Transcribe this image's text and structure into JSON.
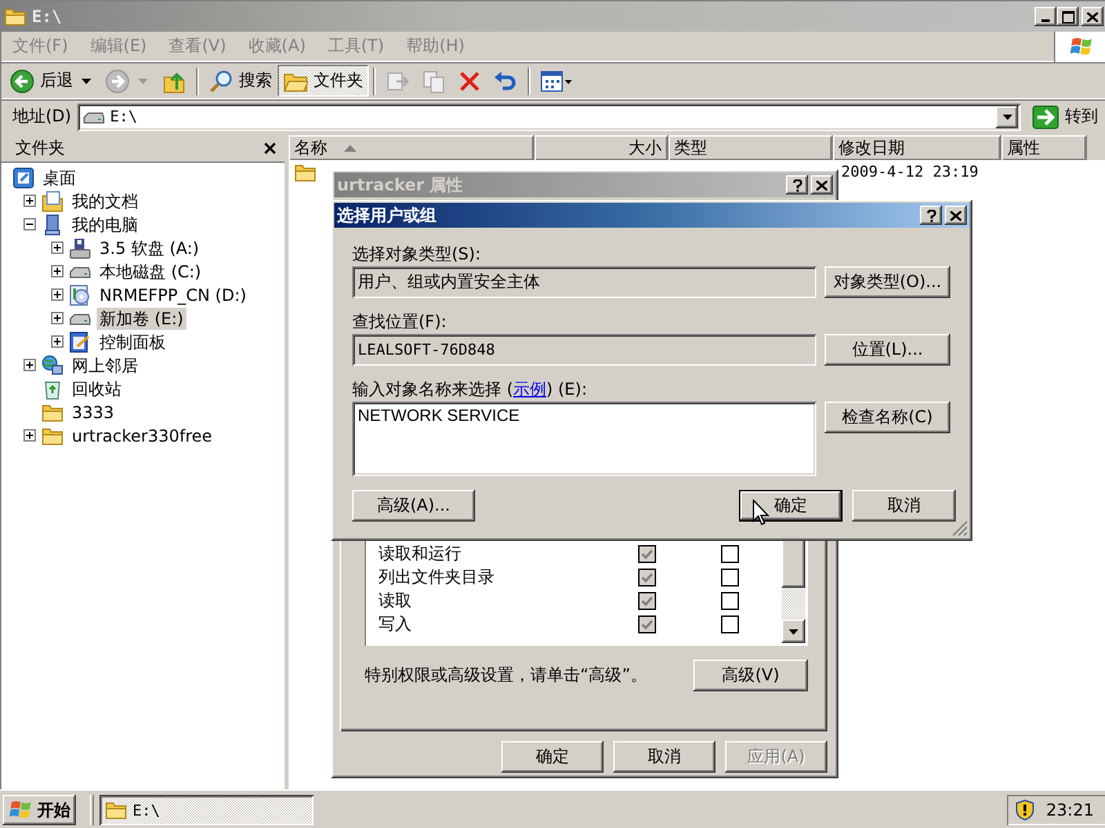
{
  "explorer": {
    "title": "E:\\",
    "menu": [
      "文件(F)",
      "编辑(E)",
      "查看(V)",
      "收藏(A)",
      "工具(T)",
      "帮助(H)"
    ],
    "toolbar": [
      {
        "kind": "back",
        "label": "后退"
      },
      {
        "kind": "forward"
      },
      {
        "kind": "up"
      },
      {
        "kind": "search",
        "label": "搜索",
        "pressed": false
      },
      {
        "kind": "folders",
        "label": "文件夹",
        "pressed": true
      },
      {
        "kind": "move"
      },
      {
        "kind": "copy"
      },
      {
        "kind": "delete"
      },
      {
        "kind": "undo"
      },
      {
        "kind": "views"
      }
    ],
    "address": {
      "label": "地址(D)",
      "value": "E:\\",
      "go": "转到"
    },
    "folders_pane": {
      "title": "文件夹",
      "tree": [
        {
          "label": "桌面",
          "kind": "desktop",
          "expandable": false,
          "selected": false,
          "children": [
            {
              "label": "我的文档",
              "kind": "documents",
              "expandable": true,
              "expanded": false,
              "selected": false
            },
            {
              "label": "我的电脑",
              "kind": "computer",
              "expandable": true,
              "expanded": true,
              "selected": false,
              "children": [
                {
                  "label": "3.5 软盘 (A:)",
                  "kind": "floppy",
                  "expandable": true,
                  "expanded": false,
                  "selected": false
                },
                {
                  "label": "本地磁盘 (C:)",
                  "kind": "drive",
                  "expandable": true,
                  "expanded": false,
                  "selected": false
                },
                {
                  "label": "NRMEFPP_CN (D:)",
                  "kind": "cd",
                  "expandable": true,
                  "expanded": false,
                  "selected": false
                },
                {
                  "label": "新加卷 (E:)",
                  "kind": "drive",
                  "expandable": true,
                  "expanded": false,
                  "selected": true
                },
                {
                  "label": "控制面板",
                  "kind": "control",
                  "expandable": true,
                  "expanded": false,
                  "selected": false
                }
              ]
            },
            {
              "label": "网上邻居",
              "kind": "network",
              "expandable": true,
              "expanded": false,
              "selected": false
            },
            {
              "label": "回收站",
              "kind": "recycle",
              "expandable": false,
              "selected": false
            },
            {
              "label": "3333",
              "kind": "folder",
              "expandable": false,
              "selected": false
            },
            {
              "label": "urtracker330free",
              "kind": "folder",
              "expandable": true,
              "expanded": false,
              "selected": false
            }
          ]
        }
      ]
    },
    "file_list": {
      "columns": [
        {
          "label": "名称",
          "sorted": true
        },
        {
          "label": "大小",
          "sorted": false
        },
        {
          "label": "类型",
          "sorted": false
        },
        {
          "label": "修改日期",
          "sorted": false
        },
        {
          "label": "属性",
          "sorted": false
        }
      ],
      "rows": [
        {
          "modified": "2009-4-12 23:19"
        }
      ]
    }
  },
  "properties_dialog": {
    "title": "urtracker 属性",
    "permissions": [
      {
        "name": "读取和运行",
        "allow": true,
        "allow_inherited": true,
        "deny": false
      },
      {
        "name": "列出文件夹目录",
        "allow": true,
        "allow_inherited": true,
        "deny": false
      },
      {
        "name": "读取",
        "allow": true,
        "allow_inherited": true,
        "deny": false
      },
      {
        "name": "写入",
        "allow": true,
        "allow_inherited": true,
        "deny": false
      }
    ],
    "advanced_hint": "特别权限或高级设置，请单击“高级”。",
    "advanced_button": "高级(V)",
    "buttons": [
      {
        "label": "确定",
        "disabled": false
      },
      {
        "label": "取消",
        "disabled": false
      },
      {
        "label": "应用(A)",
        "disabled": true
      }
    ]
  },
  "select_dialog": {
    "title": "选择用户或组",
    "object_type_label": "选择对象类型(S):",
    "object_type": "用户、组或内置安全主体",
    "object_type_button": "对象类型(O)...",
    "location_label": "查找位置(F):",
    "location": "LEALSOFT-76D848",
    "location_button": "位置(L)...",
    "names_label_before": "输入对象名称来选择 (",
    "example_link": "示例",
    "names_label_after": ") (E):",
    "names_value": "NETWORK SERVICE",
    "check_button": "检查名称(C)",
    "advanced_button": "高级(A)...",
    "ok_button": "确定",
    "cancel_button": "取消"
  },
  "taskbar": {
    "start": "开始",
    "tasks": [
      {
        "label": "E:\\",
        "selected": true
      }
    ],
    "clock": "23:21"
  }
}
